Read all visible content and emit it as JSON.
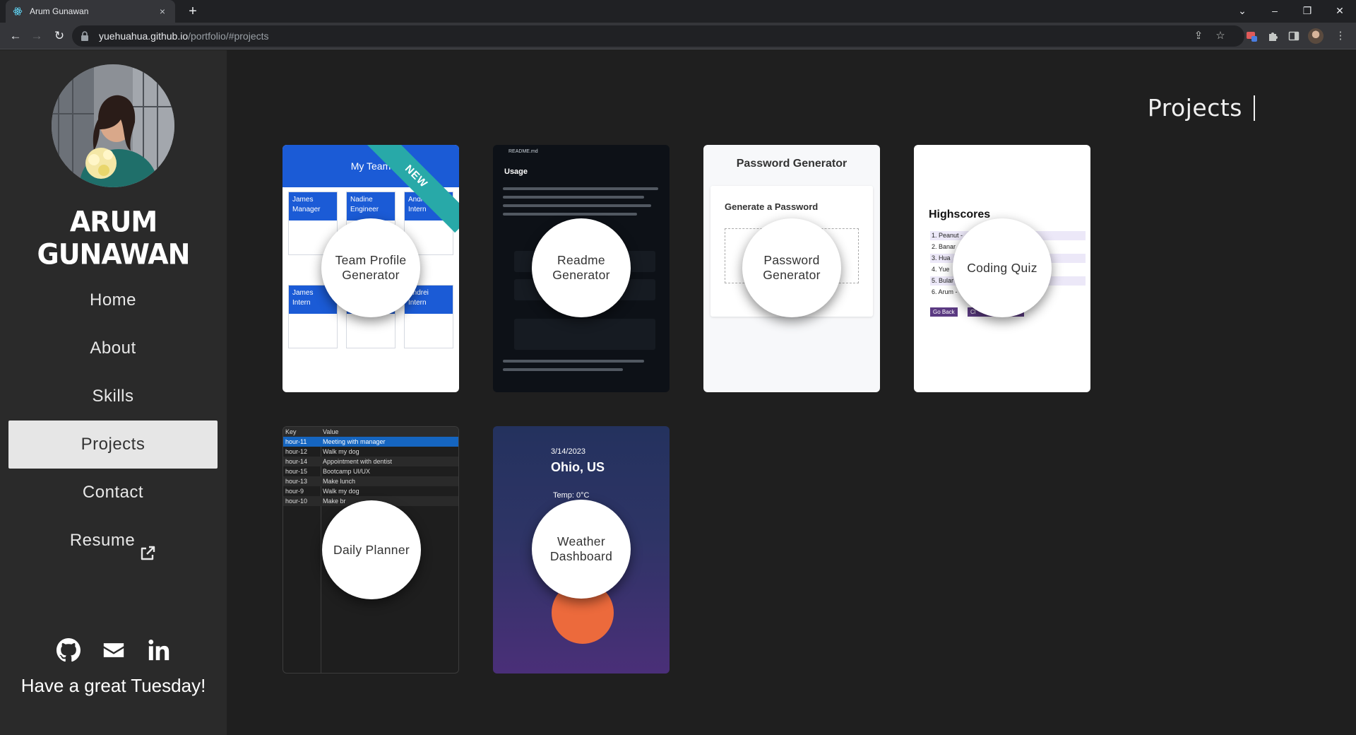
{
  "browser": {
    "tab_title": "Arum Gunawan",
    "tab_close": "×",
    "new_tab": "+",
    "url_host": "yuehuahua.github.io",
    "url_path": "/portfolio/#projects"
  },
  "sidebar": {
    "name": "ARUM GUNAWAN",
    "nav": [
      {
        "label": "Home"
      },
      {
        "label": "About"
      },
      {
        "label": "Skills"
      },
      {
        "label": "Projects",
        "active": true
      },
      {
        "label": "Contact"
      },
      {
        "label": "Resume"
      }
    ],
    "socials": [
      "github-icon",
      "email-icon",
      "linkedin-icon"
    ],
    "greeting": "Have a great Tuesday!"
  },
  "main": {
    "title": "Projects",
    "projects": [
      {
        "label": "Team Profile Generator",
        "badge": "NEW",
        "preview": {
          "header": "My Team",
          "members": [
            {
              "name": "James",
              "role": "Manager"
            },
            {
              "name": "Nadine",
              "role": "Engineer"
            },
            {
              "name": "Andrei",
              "role": "Intern"
            },
            {
              "name": "James",
              "role": "Intern"
            },
            {
              "name": "",
              "role": ""
            },
            {
              "name": "Andrei",
              "role": "Intern"
            }
          ]
        }
      },
      {
        "label": "Readme Generator",
        "preview": {
          "file": "README.md",
          "heading": "Usage"
        }
      },
      {
        "label": "Password Generator",
        "preview": {
          "title": "Password Generator",
          "subtitle": "Generate a Password"
        }
      },
      {
        "label": "Coding Quiz",
        "preview": {
          "title": "Highscores",
          "rows": [
            "1. Peanut -",
            "2. Banar",
            "3. Hua",
            "4. Yue",
            "5. Bular",
            "6. Arum -"
          ],
          "go_back": "Go Back",
          "clear": "Cl"
        }
      },
      {
        "label": "Daily Planner",
        "preview": {
          "col_key": "Key",
          "col_value": "Value",
          "rows": [
            {
              "k": "hour-11",
              "v": "Meeting with manager"
            },
            {
              "k": "hour-12",
              "v": "Walk my dog"
            },
            {
              "k": "hour-14",
              "v": "Appointment with dentist"
            },
            {
              "k": "hour-15",
              "v": "Bootcamp UI/UX"
            },
            {
              "k": "hour-13",
              "v": "Make lunch"
            },
            {
              "k": "hour-9",
              "v": "Walk my dog"
            },
            {
              "k": "hour-10",
              "v": "Make br"
            }
          ]
        }
      },
      {
        "label": "Weather Dashboard",
        "preview": {
          "date": "3/14/2023",
          "city": "Ohio, US",
          "temp": "Temp: 0°C"
        }
      }
    ]
  },
  "colors": {
    "sidebar_bg": "#2a2a2a",
    "main_bg": "#1f1f1f",
    "active_nav_bg": "#e6e6e6",
    "ribbon": "#28a9a8",
    "team_blue": "#1b5bd6"
  }
}
